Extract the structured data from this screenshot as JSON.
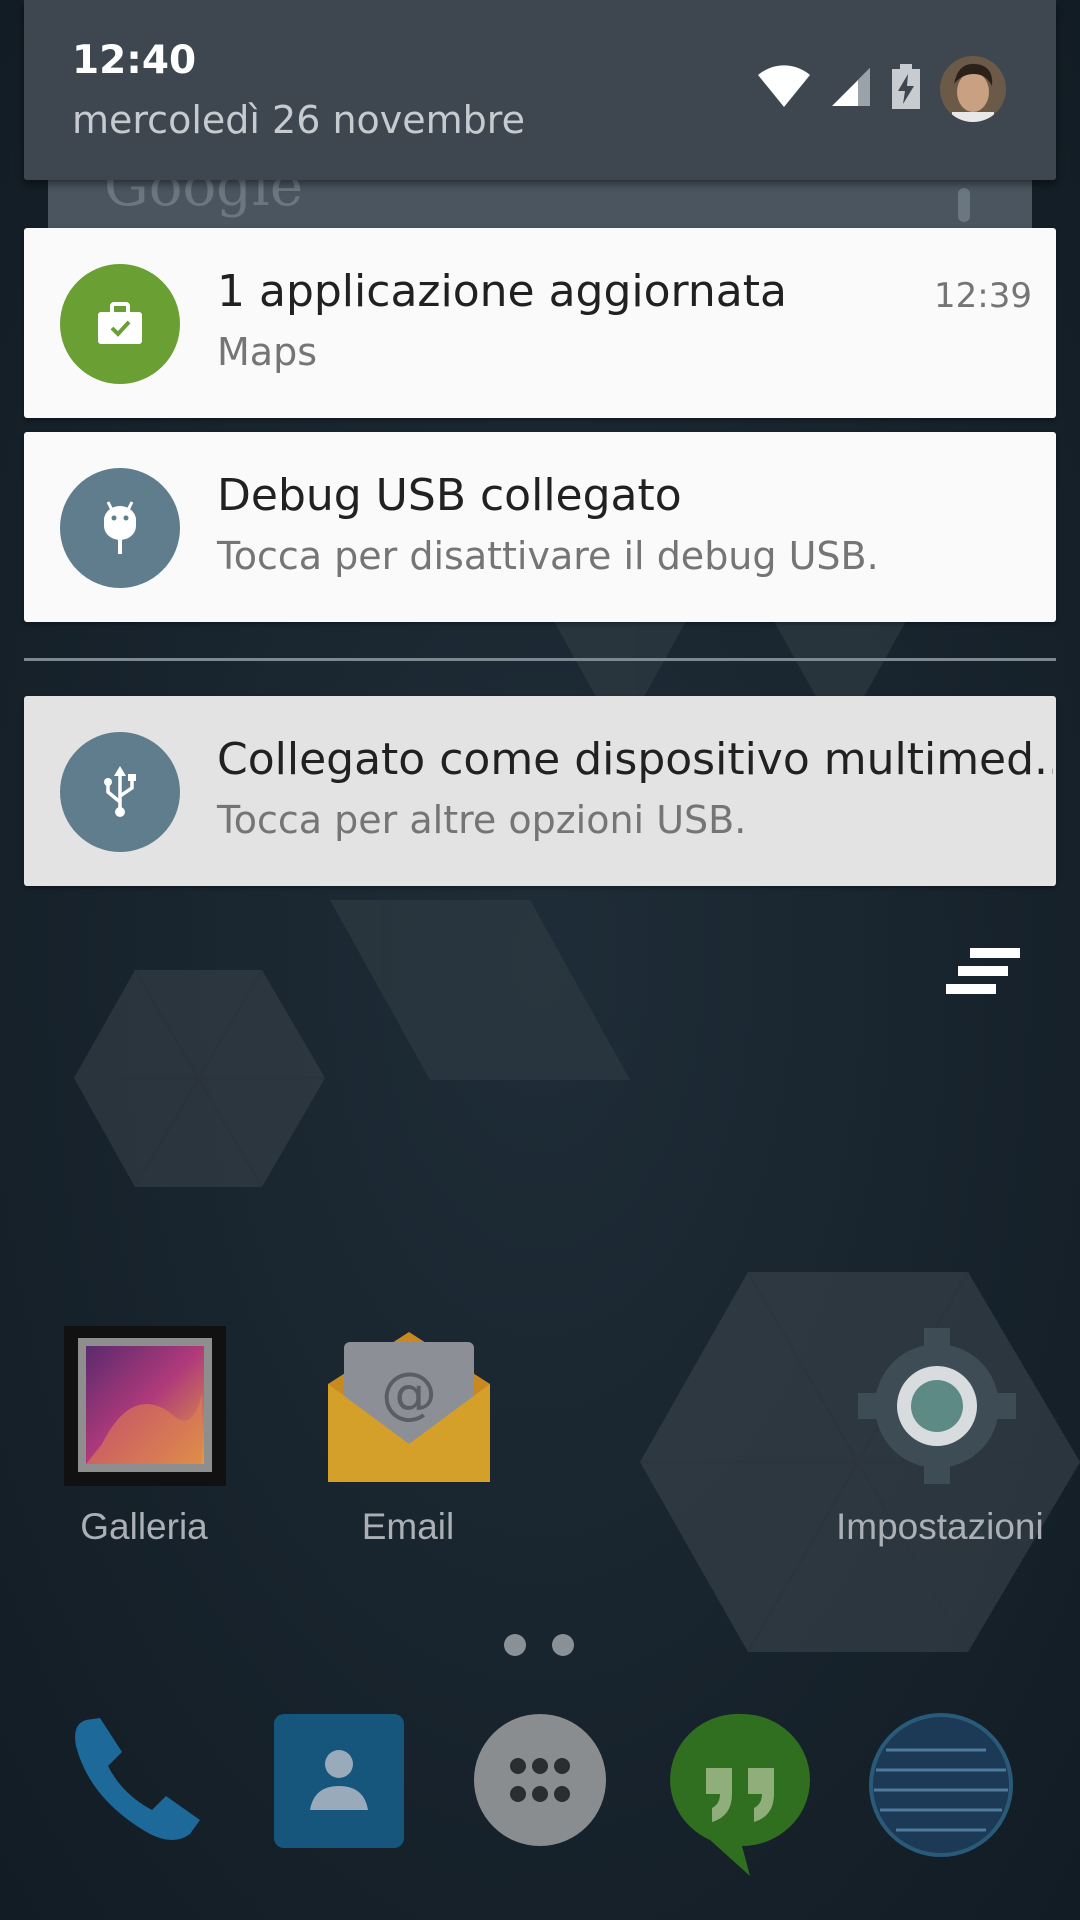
{
  "status": {
    "time": "12:40",
    "date": "mercoledì 26 novembre",
    "icons": [
      "wifi-icon",
      "cell-signal-icon",
      "battery-charging-icon",
      "user-avatar"
    ]
  },
  "notifications": [
    {
      "title": "1 applicazione aggiornata",
      "text": "Maps",
      "time": "12:39",
      "icon": "play-store-briefcase-icon",
      "icon_color": "#6a9f33"
    },
    {
      "title": "Debug USB collegato",
      "text": "Tocca per disattivare il debug USB.",
      "icon": "android-debug-icon",
      "icon_color": "#5f7d8c"
    },
    {
      "title": "Collegato come dispositivo multimed..",
      "text": "Tocca per altre opzioni USB.",
      "icon": "usb-icon",
      "icon_color": "#5f7d8c"
    }
  ],
  "clear_all_icon": "clear-all-icon",
  "home_apps": [
    {
      "label": "Galleria",
      "icon": "gallery-icon"
    },
    {
      "label": "Email",
      "icon": "email-icon"
    },
    {
      "label": "Impostazioni",
      "icon": "settings-gear-icon"
    }
  ],
  "page_indicator": {
    "pages": 2
  },
  "dock": [
    "phone-icon",
    "contacts-icon",
    "app-drawer-icon",
    "hangouts-icon",
    "browser-globe-icon"
  ]
}
